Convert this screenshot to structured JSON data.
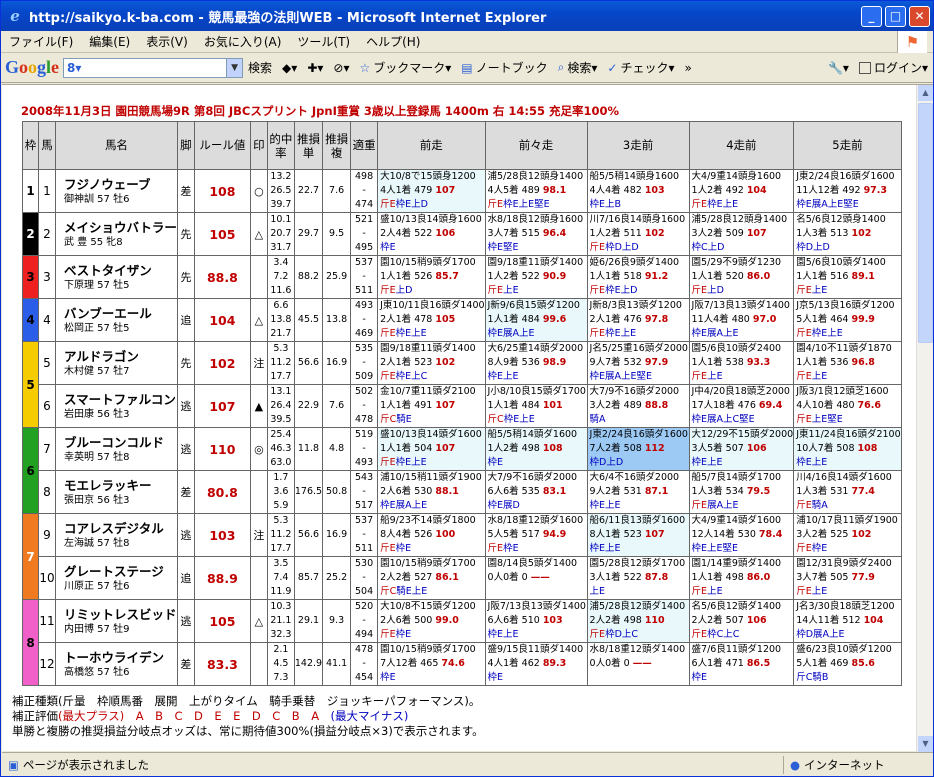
{
  "window": {
    "title": "http://saikyo.k-ba.com - 競馬最強の法則WEB - Microsoft Internet Explorer"
  },
  "menu": [
    "ファイル(F)",
    "編集(E)",
    "表示(V)",
    "お気に入り(A)",
    "ツール(T)",
    "ヘルプ(H)"
  ],
  "google_bar": {
    "logo": [
      "G",
      "o",
      "o",
      "g",
      "l",
      "e"
    ],
    "search_value": "8",
    "search_btn": "検索",
    "bookmark": "ブックマーク",
    "notebook": "ノートブック",
    "search2": "検索",
    "check": "チェック",
    "more": "»",
    "login": "ログイン"
  },
  "page": {
    "heading": "2008年11月3日 園田競馬場9R 第8回 JBCスプリント JpnI重賞 3歳以上登録馬 1400m 右 14:55 充足率100%",
    "headers": [
      "枠",
      "馬",
      "馬名",
      "脚",
      "ルール値",
      "印",
      "的中率",
      "推損単",
      "推損複",
      "適重",
      "前走",
      "前々走",
      "3走前",
      "4走前",
      "5走前"
    ],
    "frame_colors": {
      "1": "#ffffff",
      "2": "#000000",
      "3": "#ee2020",
      "4": "#2a5ee8",
      "5": "#f5cc00",
      "6": "#22a022",
      "7": "#f07a20",
      "8": "#f060c8"
    },
    "horses": [
      {
        "waku": "1",
        "uma": "1",
        "name": "フジノウェーブ",
        "jockey": "御神訓 57 牡6",
        "kyaku": "差",
        "rule": "108",
        "mark": "○",
        "rate": [
          "13.2",
          "26.5",
          "39.7"
        ],
        "tan": "22.7",
        "fuku": "7.6",
        "tj": [
          "498",
          "-",
          "474"
        ],
        "races": [
          {
            "l1": "大10/8で15頭身1200",
            "l2a": "4人1着 479 ",
            "v": "107",
            "l3f": "斤E",
            "l3": "枠E上D",
            "hl": "hl"
          },
          {
            "l1": "浦5/28良12頭身1400",
            "l2a": "4人5着 489 ",
            "v": "98.1",
            "l3f": "斤E",
            "l3": "枠E上E堅E",
            "hl": ""
          },
          {
            "l1": "船5/5稍14頭身1600",
            "l2a": "4人4着 482 ",
            "v": "103",
            "l3f": "",
            "l3": "枠E上B",
            "hl": ""
          },
          {
            "l1": "大4/9重14頭身1600",
            "l2a": "1人2着 492 ",
            "v": "104",
            "l3f": "斤E",
            "l3": "枠E上E",
            "hl": ""
          },
          {
            "l1": "J東2/24良16頭ダ1600",
            "l2a": "11人12着 492 ",
            "v": "97.3",
            "l3f": "",
            "l3": "枠E展A上E堅E",
            "hl": ""
          }
        ]
      },
      {
        "waku": "2",
        "uma": "2",
        "name": "メイショウバトラー",
        "jockey": "武 豊 55 牝8",
        "kyaku": "先",
        "rule": "105",
        "mark": "△",
        "rate": [
          "10.1",
          "20.7",
          "31.7"
        ],
        "tan": "29.7",
        "fuku": "9.5",
        "tj": [
          "521",
          "-",
          "495"
        ],
        "races": [
          {
            "l1": "盛10/13良14頭身1600",
            "l2a": "2人4着 522 ",
            "v": "106",
            "l3f": "",
            "l3": "枠E",
            "hl": ""
          },
          {
            "l1": "水8/18良12頭身1600",
            "l2a": "3人7着 515 ",
            "v": "96.4",
            "l3f": "",
            "l3": "枠E堅E",
            "hl": ""
          },
          {
            "l1": "川7/16良14頭身1600",
            "l2a": "1人2着 511 ",
            "v": "102",
            "l3f": "斤E",
            "l3": "枠D上D",
            "hl": ""
          },
          {
            "l1": "浦5/28良12頭身1400",
            "l2a": "3人2着 509 ",
            "v": "107",
            "l3f": "",
            "l3": "枠C上D",
            "hl": ""
          },
          {
            "l1": "名5/6良12頭身1400",
            "l2a": "1人3着 513 ",
            "v": "102",
            "l3f": "",
            "l3": "枠D上D",
            "hl": ""
          }
        ]
      },
      {
        "waku": "3",
        "uma": "3",
        "name": "ベストタイザン",
        "jockey": "下原理 57 牡5",
        "kyaku": "先",
        "rule": "88.8",
        "mark": "",
        "rate": [
          "3.4",
          "7.2",
          "11.6"
        ],
        "tan": "88.2",
        "fuku": "25.9",
        "tj": [
          "537",
          "-",
          "511"
        ],
        "races": [
          {
            "l1": "園10/15稍9頭ダ1700",
            "l2a": "1人1着 526 ",
            "v": "85.7",
            "l3f": "斤E",
            "l3": "上D",
            "hl": ""
          },
          {
            "l1": "園9/18重11頭ダ1400",
            "l2a": "1人2着 522 ",
            "v": "90.9",
            "l3f": "斤E",
            "l3": "上E",
            "hl": ""
          },
          {
            "l1": "姫6/26良9頭ダ1400",
            "l2a": "1人1着 518 ",
            "v": "91.2",
            "l3f": "斤E",
            "l3": "枠E上D",
            "hl": ""
          },
          {
            "l1": "園5/29不9頭ダ1230",
            "l2a": "1人1着 520 ",
            "v": "86.0",
            "l3f": "斤E",
            "l3": "上D",
            "hl": ""
          },
          {
            "l1": "園5/6良10頭ダ1400",
            "l2a": "1人1着 516 ",
            "v": "89.1",
            "l3f": "斤E",
            "l3": "上E",
            "hl": ""
          }
        ]
      },
      {
        "waku": "4",
        "uma": "4",
        "name": "バンブーエール",
        "jockey": "松岡正 57 牡5",
        "kyaku": "追",
        "rule": "104",
        "mark": "△",
        "rate": [
          "6.6",
          "13.8",
          "21.7"
        ],
        "tan": "45.5",
        "fuku": "13.8",
        "tj": [
          "493",
          "-",
          "469"
        ],
        "races": [
          {
            "l1": "J東10/11良16頭ダ1400",
            "l2a": "2人1着 478 ",
            "v": "105",
            "l3f": "斤E",
            "l3": "枠E上E",
            "hl": ""
          },
          {
            "l1": "J新9/6良15頭ダ1200",
            "l2a": "1人1着 484 ",
            "v": "99.6",
            "l3f": "",
            "l3": "枠E展A上E",
            "hl": "hl"
          },
          {
            "l1": "J新8/3良13頭ダ1200",
            "l2a": "2人1着 476 ",
            "v": "97.8",
            "l3f": "斤E",
            "l3": "枠E上E",
            "hl": ""
          },
          {
            "l1": "J阪7/13良13頭ダ1400",
            "l2a": "11人4着 480 ",
            "v": "97.0",
            "l3f": "",
            "l3": "枠E展A上E",
            "hl": ""
          },
          {
            "l1": "J京5/13良16頭ダ1200",
            "l2a": "5人1着 464 ",
            "v": "99.9",
            "l3f": "斤E",
            "l3": "枠E上E",
            "hl": ""
          }
        ]
      },
      {
        "waku": "5",
        "uma": "5",
        "name": "アルドラゴン",
        "jockey": "木村健 57 牡7",
        "kyaku": "先",
        "rule": "102",
        "mark": "注",
        "rate": [
          "5.3",
          "11.2",
          "17.7"
        ],
        "tan": "56.6",
        "fuku": "16.9",
        "tj": [
          "535",
          "-",
          "509"
        ],
        "races": [
          {
            "l1": "園9/18重11頭ダ1400",
            "l2a": "2人1着 523 ",
            "v": "102",
            "l3f": "斤E",
            "l3": "枠E上C",
            "hl": ""
          },
          {
            "l1": "大6/25重14頭ダ2000",
            "l2a": "8人9着 536 ",
            "v": "98.9",
            "l3f": "",
            "l3": "枠E上E",
            "hl": ""
          },
          {
            "l1": "J名5/25重16頭ダ2000",
            "l2a": "9人7着 532 ",
            "v": "97.9",
            "l3f": "",
            "l3": "枠E展A上E堅E",
            "hl": ""
          },
          {
            "l1": "園5/6良10頭ダ2400",
            "l2a": "1人1着 538 ",
            "v": "93.3",
            "l3f": "斤E",
            "l3": "上E",
            "hl": ""
          },
          {
            "l1": "園4/10不11頭ダ1870",
            "l2a": "1人1着 536 ",
            "v": "96.8",
            "l3f": "斤E",
            "l3": "上E",
            "hl": ""
          }
        ]
      },
      {
        "waku": "5",
        "uma": "6",
        "name": "スマートファルコン",
        "jockey": "岩田康 56 牡3",
        "kyaku": "逃",
        "rule": "107",
        "mark": "▲",
        "rate": [
          "13.1",
          "26.4",
          "39.5"
        ],
        "tan": "22.9",
        "fuku": "7.6",
        "tj": [
          "502",
          "-",
          "478"
        ],
        "races": [
          {
            "l1": "金10/7重11頭ダ2100",
            "l2a": "1人1着 491 ",
            "v": "107",
            "l3f": "斤C",
            "l3": "騎E",
            "hl": ""
          },
          {
            "l1": "J小8/10良15頭ダ1700",
            "l2a": "1人1着 484 ",
            "v": "101",
            "l3f": "斤C",
            "l3": "枠E上E",
            "hl": ""
          },
          {
            "l1": "大7/9不16頭ダ2000",
            "l2a": "3人2着 489 ",
            "v": "88.8",
            "l3f": "",
            "l3": "騎A",
            "hl": ""
          },
          {
            "l1": "J中4/20良18頭芝2000",
            "l2a": "17人18着 476 ",
            "v": "69.4",
            "l3f": "",
            "l3": "枠E展A上C堅E",
            "hl": ""
          },
          {
            "l1": "J阪3/1良12頭芝1600",
            "l2a": "4人10着 480 ",
            "v": "76.6",
            "l3f": "斤E",
            "l3": "上E堅E",
            "hl": ""
          }
        ]
      },
      {
        "waku": "6",
        "uma": "7",
        "name": "ブルーコンコルド",
        "jockey": "幸英明 57 牡8",
        "kyaku": "逃",
        "rule": "110",
        "mark": "◎",
        "rate": [
          "25.4",
          "46.3",
          "63.0"
        ],
        "tan": "11.8",
        "fuku": "4.8",
        "tj": [
          "519",
          "-",
          "493"
        ],
        "races": [
          {
            "l1": "盛10/13良14頭ダ1600",
            "l2a": "1人1着 504 ",
            "v": "107",
            "l3f": "斤E",
            "l3": "枠E上E",
            "hl": "hl"
          },
          {
            "l1": "船5/5稍14頭ダ1600",
            "l2a": "1人2着 498 ",
            "v": "108",
            "l3f": "",
            "l3": "枠E",
            "hl": "hl"
          },
          {
            "l1": "J東2/24良16頭ダ1600",
            "l2a": "7人2着 508 ",
            "v": "112",
            "l3f": "",
            "l3": "枠D上D",
            "hl": "hl2"
          },
          {
            "l1": "大12/29不15頭ダ2000",
            "l2a": "3人5着 507 ",
            "v": "106",
            "l3f": "",
            "l3": "枠E上E",
            "hl": "hl"
          },
          {
            "l1": "J東11/24良16頭ダ2100",
            "l2a": "10人7着 508 ",
            "v": "108",
            "l3f": "",
            "l3": "枠E上E",
            "hl": "hl"
          }
        ]
      },
      {
        "waku": "6",
        "uma": "8",
        "name": "モエレラッキー",
        "jockey": "張田京 56 牡3",
        "kyaku": "差",
        "rule": "80.8",
        "mark": "",
        "rate": [
          "1.7",
          "3.6",
          "5.9"
        ],
        "tan": "176.5",
        "fuku": "50.8",
        "tj": [
          "543",
          "-",
          "517"
        ],
        "races": [
          {
            "l1": "浦10/15稍11頭ダ1900",
            "l2a": "2人6着 530 ",
            "v": "88.1",
            "l3f": "",
            "l3": "枠E展A上E",
            "hl": ""
          },
          {
            "l1": "大7/9不16頭ダ2000",
            "l2a": "6人6着 535 ",
            "v": "83.1",
            "l3f": "",
            "l3": "枠E展D",
            "hl": ""
          },
          {
            "l1": "大6/4不16頭ダ2000",
            "l2a": "9人2着 531 ",
            "v": "87.1",
            "l3f": "",
            "l3": "枠E上E",
            "hl": ""
          },
          {
            "l1": "船5/7良14頭ダ1700",
            "l2a": "1人3着 534 ",
            "v": "79.5",
            "l3f": "斤E",
            "l3": "展A上E",
            "hl": ""
          },
          {
            "l1": "川4/16良14頭ダ1600",
            "l2a": "1人3着 531 ",
            "v": "77.4",
            "l3f": "斤E",
            "l3": "騎A",
            "hl": ""
          }
        ]
      },
      {
        "waku": "7",
        "uma": "9",
        "name": "コアレスデジタル",
        "jockey": "左海誠 57 牡8",
        "kyaku": "逃",
        "rule": "103",
        "mark": "注",
        "rate": [
          "5.3",
          "11.2",
          "17.7"
        ],
        "tan": "56.6",
        "fuku": "16.9",
        "tj": [
          "537",
          "-",
          "511"
        ],
        "races": [
          {
            "l1": "船9/23不14頭ダ1800",
            "l2a": "8人4着 526 ",
            "v": "100",
            "l3f": "斤E",
            "l3": "枠E",
            "hl": ""
          },
          {
            "l1": "水8/18重12頭ダ1600",
            "l2a": "5人5着 517 ",
            "v": "94.9",
            "l3f": "斤E",
            "l3": "枠E",
            "hl": ""
          },
          {
            "l1": "船6/11良13頭ダ1600",
            "l2a": "8人1着 523 ",
            "v": "107",
            "l3f": "",
            "l3": "枠E上E",
            "hl": "hl"
          },
          {
            "l1": "大4/9重14頭ダ1600",
            "l2a": "12人14着 530 ",
            "v": "78.4",
            "l3f": "",
            "l3": "枠E上E堅E",
            "hl": ""
          },
          {
            "l1": "浦10/17良11頭ダ1900",
            "l2a": "3人2着 525 ",
            "v": "102",
            "l3f": "斤E",
            "l3": "枠E",
            "hl": ""
          }
        ]
      },
      {
        "waku": "7",
        "uma": "10",
        "name": "グレートステージ",
        "jockey": "川原正 57 牡6",
        "kyaku": "追",
        "rule": "88.9",
        "mark": "",
        "rate": [
          "3.5",
          "7.4",
          "11.9"
        ],
        "tan": "85.7",
        "fuku": "25.2",
        "tj": [
          "530",
          "-",
          "504"
        ],
        "races": [
          {
            "l1": "園10/15稍9頭ダ1700",
            "l2a": "2人2着 527 ",
            "v": "86.1",
            "l3f": "斤C",
            "l3": "騎E上E",
            "hl": ""
          },
          {
            "l1": "園8/14良5頭ダ1400",
            "l2a": "0人0着 0 ",
            "v": "——",
            "l3f": "",
            "l3": "",
            "hl": ""
          },
          {
            "l1": "園5/28良12頭ダ1700",
            "l2a": "3人1着 522 ",
            "v": "87.8",
            "l3f": "",
            "l3": "上E",
            "hl": ""
          },
          {
            "l1": "園1/14重9頭ダ1400",
            "l2a": "1人1着 498 ",
            "v": "86.0",
            "l3f": "斤E",
            "l3": "上E",
            "hl": ""
          },
          {
            "l1": "園12/31良9頭ダ2400",
            "l2a": "3人7着 505 ",
            "v": "77.9",
            "l3f": "斤E",
            "l3": "上E",
            "hl": ""
          }
        ]
      },
      {
        "waku": "8",
        "uma": "11",
        "name": "リミットレスビッド",
        "jockey": "内田博 57 牡9",
        "kyaku": "逃",
        "rule": "105",
        "mark": "△",
        "rate": [
          "10.3",
          "21.1",
          "32.3"
        ],
        "tan": "29.1",
        "fuku": "9.3",
        "tj": [
          "520",
          "-",
          "494"
        ],
        "races": [
          {
            "l1": "大10/8不15頭ダ1200",
            "l2a": "2人6着 500 ",
            "v": "99.0",
            "l3f": "斤E",
            "l3": "枠E",
            "hl": ""
          },
          {
            "l1": "J阪7/13良13頭ダ1400",
            "l2a": "6人6着 510 ",
            "v": "103",
            "l3f": "",
            "l3": "枠E上E",
            "hl": ""
          },
          {
            "l1": "浦5/28良12頭ダ1400",
            "l2a": "2人2着 498 ",
            "v": "110",
            "l3f": "斤E",
            "l3": "枠D上C",
            "hl": "hl"
          },
          {
            "l1": "名5/6良12頭ダ1400",
            "l2a": "2人2着 507 ",
            "v": "106",
            "l3f": "斤E",
            "l3": "枠C上C",
            "hl": ""
          },
          {
            "l1": "J名3/30良18頭芝1200",
            "l2a": "14人11着 512 ",
            "v": "104",
            "l3f": "",
            "l3": "枠D展A上E",
            "hl": ""
          }
        ]
      },
      {
        "waku": "8",
        "uma": "12",
        "name": "トーホウライデン",
        "jockey": "高橋悠 57 牡6",
        "kyaku": "差",
        "rule": "83.3",
        "mark": "",
        "rate": [
          "2.1",
          "4.5",
          "7.3"
        ],
        "tan": "142.9",
        "fuku": "41.1",
        "tj": [
          "478",
          "-",
          "454"
        ],
        "races": [
          {
            "l1": "園10/15稍9頭ダ1700",
            "l2a": "7人12着 465 ",
            "v": "74.6",
            "l3f": "",
            "l3": "枠E",
            "hl": ""
          },
          {
            "l1": "盛9/15良11頭ダ1400",
            "l2a": "4人1着 462 ",
            "v": "89.3",
            "l3f": "",
            "l3": "枠E",
            "hl": ""
          },
          {
            "l1": "水8/18重12頭ダ1400",
            "l2a": "0人0着 0 ",
            "v": "——",
            "l3f": "",
            "l3": "",
            "hl": ""
          },
          {
            "l1": "盛7/6良11頭ダ1200",
            "l2a": "6人1着 471 ",
            "v": "86.5",
            "l3f": "",
            "l3": "枠E",
            "hl": ""
          },
          {
            "l1": "盛6/23良10頭ダ1200",
            "l2a": "5人1着 469 ",
            "v": "85.6",
            "l3f": "",
            "l3": "斤C騎B",
            "hl": ""
          }
        ]
      }
    ],
    "notes": {
      "line1": "補正種類(斤量　枠順馬番　展開　上がりタイム　騎手乗替　ジョッキーパフォーマンス)。",
      "line2_a": "補正評価",
      "line2_b": "(最大プラス)　A　B　C　D　E　E　D　C　B　A",
      "line2_c": "　(最大マイナス)",
      "line3": "単勝と複勝の推奨損益分岐点オッズは、常に期待値300%(損益分岐点×3)で表示されます。"
    }
  },
  "status": {
    "text": "ページが表示されました",
    "zone": "インターネット"
  }
}
